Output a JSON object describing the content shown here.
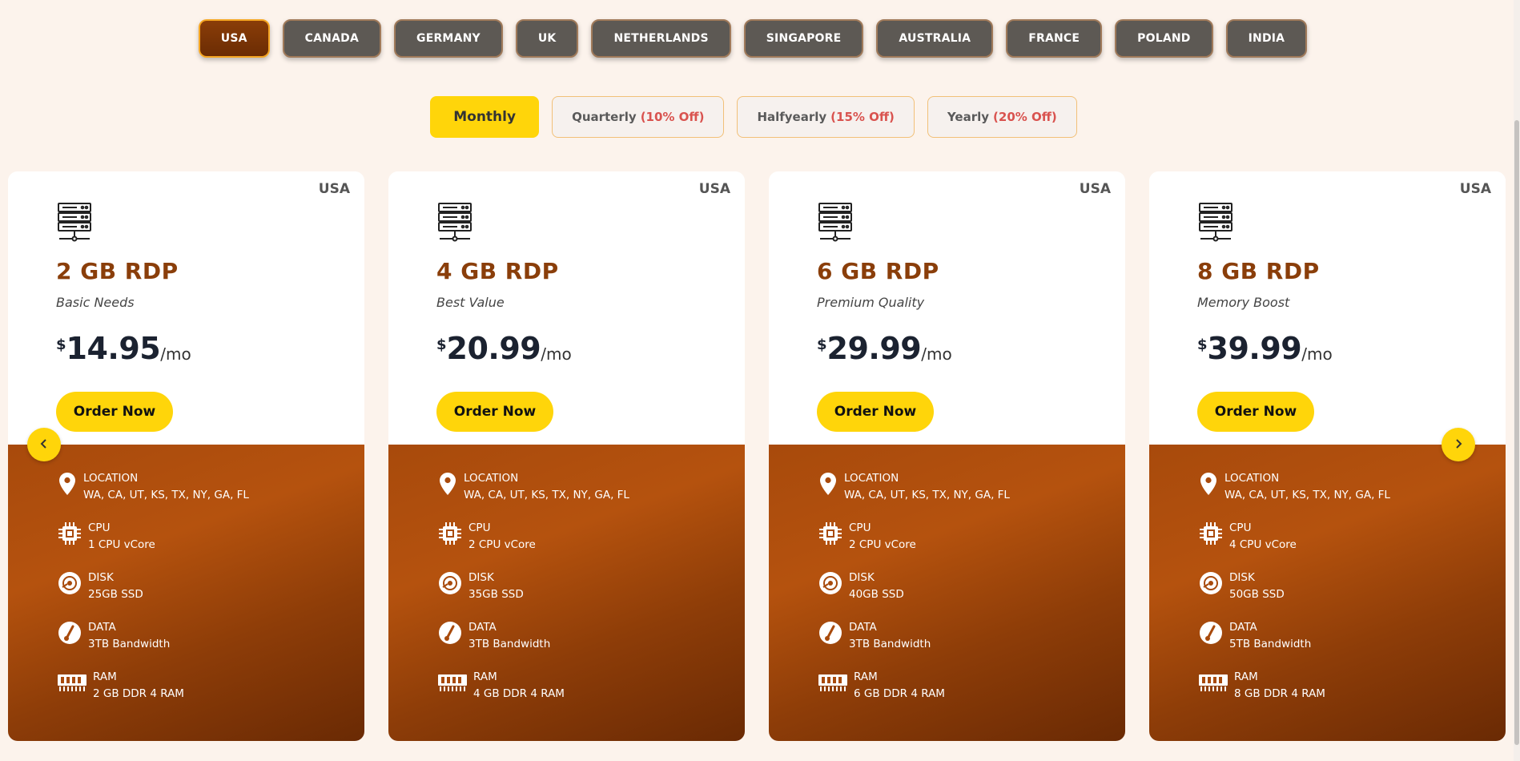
{
  "countries": [
    {
      "label": "USA",
      "active": true
    },
    {
      "label": "CANADA",
      "active": false
    },
    {
      "label": "GERMANY",
      "active": false
    },
    {
      "label": "UK",
      "active": false
    },
    {
      "label": "NETHERLANDS",
      "active": false
    },
    {
      "label": "SINGAPORE",
      "active": false
    },
    {
      "label": "AUSTRALIA",
      "active": false
    },
    {
      "label": "FRANCE",
      "active": false
    },
    {
      "label": "POLAND",
      "active": false
    },
    {
      "label": "INDIA",
      "active": false
    }
  ],
  "billing": [
    {
      "label": "Monthly",
      "off": "",
      "active": true
    },
    {
      "label": "Quarterly",
      "off": "(10% Off)",
      "active": false
    },
    {
      "label": "Halfyearly",
      "off": "(15% Off)",
      "active": false
    },
    {
      "label": "Yearly",
      "off": "(20% Off)",
      "active": false
    }
  ],
  "plans": [
    {
      "country": "USA",
      "title": "2 GB RDP",
      "subtitle": "Basic Needs",
      "currency": "$",
      "price": "14.95",
      "period": "/mo",
      "order_label": "Order Now",
      "location_label": "LOCATION",
      "location": "WA, CA, UT, KS, TX, NY, GA, FL",
      "cpu_label": "CPU",
      "cpu": "1 CPU vCore",
      "disk_label": "DISK",
      "disk": "25GB SSD",
      "data_label": "DATA",
      "data": "3TB Bandwidth",
      "ram_label": "RAM",
      "ram": "2 GB DDR 4 RAM"
    },
    {
      "country": "USA",
      "title": "4 GB RDP",
      "subtitle": "Best Value",
      "currency": "$",
      "price": "20.99",
      "period": "/mo",
      "order_label": "Order Now",
      "location_label": "LOCATION",
      "location": "WA, CA, UT, KS, TX, NY, GA, FL",
      "cpu_label": "CPU",
      "cpu": "2 CPU vCore",
      "disk_label": "DISK",
      "disk": "35GB SSD",
      "data_label": "DATA",
      "data": "3TB Bandwidth",
      "ram_label": "RAM",
      "ram": "4 GB DDR 4 RAM"
    },
    {
      "country": "USA",
      "title": "6 GB RDP",
      "subtitle": "Premium Quality",
      "currency": "$",
      "price": "29.99",
      "period": "/mo",
      "order_label": "Order Now",
      "location_label": "LOCATION",
      "location": "WA, CA, UT, KS, TX, NY, GA, FL",
      "cpu_label": "CPU",
      "cpu": "2 CPU vCore",
      "disk_label": "DISK",
      "disk": "40GB SSD",
      "data_label": "DATA",
      "data": "3TB Bandwidth",
      "ram_label": "RAM",
      "ram": "6 GB DDR 4 RAM"
    },
    {
      "country": "USA",
      "title": "8 GB RDP",
      "subtitle": "Memory Boost",
      "currency": "$",
      "price": "39.99",
      "period": "/mo",
      "order_label": "Order Now",
      "location_label": "LOCATION",
      "location": "WA, CA, UT, KS, TX, NY, GA, FL",
      "cpu_label": "CPU",
      "cpu": "4 CPU vCore",
      "disk_label": "DISK",
      "disk": "50GB SSD",
      "data_label": "DATA",
      "data": "5TB Bandwidth",
      "ram_label": "RAM",
      "ram": "8 GB DDR 4 RAM"
    }
  ],
  "icons": {
    "server": "server-icon",
    "location": "map-pin-icon",
    "cpu": "cpu-chip-icon",
    "disk": "disk-icon",
    "data": "gauge-icon",
    "ram": "ram-module-icon",
    "prev": "chevron-left-icon",
    "next": "chevron-right-icon"
  },
  "colors": {
    "accent_yellow": "#ffd50a",
    "title_brown": "#8a3e0a",
    "active_country": "#7a3406",
    "inactive_country": "#5d5954",
    "discount_red": "#d9534f"
  }
}
